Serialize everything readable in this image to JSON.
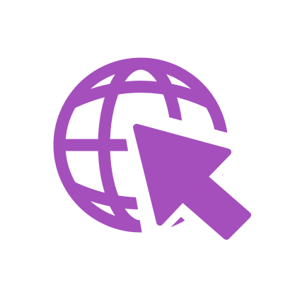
{
  "icon": {
    "name": "globe-with-cursor-icon",
    "globe_icon": "globe-icon",
    "cursor_icon": "arrow-cursor-icon",
    "color": "#a54fbd",
    "background": "#ffffff"
  }
}
